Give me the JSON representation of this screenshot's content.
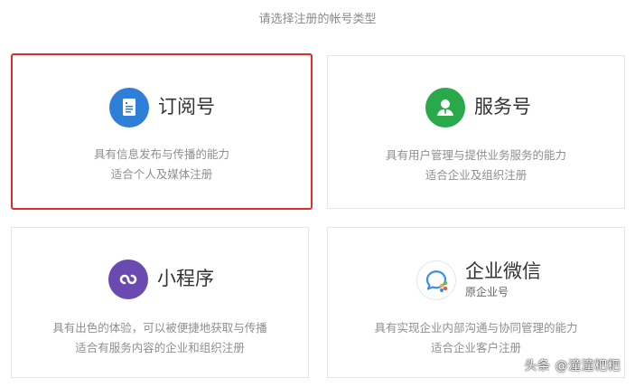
{
  "page": {
    "heading": "请选择注册的帐号类型"
  },
  "colors": {
    "selected_border": "#e12d2d",
    "subscription_icon": "#2e7fd8",
    "service_icon": "#2aa94a",
    "miniprogram_icon": "#6a4ab0"
  },
  "cards": {
    "subscription": {
      "icon": "document-icon",
      "title": "订阅号",
      "line1": "具有信息发布与传播的能力",
      "line2": "适合个人及媒体注册",
      "selected": true
    },
    "service": {
      "icon": "user-icon",
      "title": "服务号",
      "line1": "具有用户管理与提供业务服务的能力",
      "line2": "适合企业及组织注册",
      "selected": false
    },
    "miniprogram": {
      "icon": "mini-program-icon",
      "title": "小程序",
      "line1": "具有出色的体验，可以被便捷地获取与传播",
      "line2": "适合有服务内容的企业和组织注册",
      "selected": false
    },
    "wework": {
      "icon": "wework-icon",
      "title": "企业微信",
      "subtitle": "原企业号",
      "line1": "具有实现企业内部沟通与协同管理的能力",
      "line2": "适合企业客户注册",
      "selected": false
    }
  },
  "watermark": "头条 @潼潼粑粑"
}
